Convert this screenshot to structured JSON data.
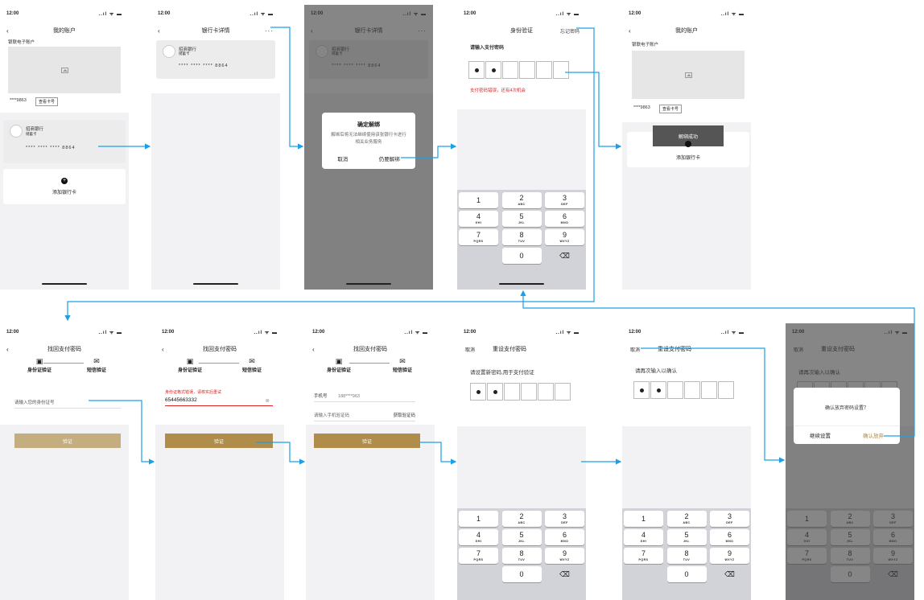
{
  "common": {
    "time": "12:00",
    "signal": "..ıl ᯤ ▬",
    "keys": [
      {
        "n": "1",
        "l": ""
      },
      {
        "n": "2",
        "l": "ABC"
      },
      {
        "n": "3",
        "l": "DEF"
      },
      {
        "n": "4",
        "l": "GHI"
      },
      {
        "n": "5",
        "l": "JKL"
      },
      {
        "n": "6",
        "l": "MNO"
      },
      {
        "n": "7",
        "l": "PQRS"
      },
      {
        "n": "8",
        "l": "TUV"
      },
      {
        "n": "9",
        "l": "WXYZ"
      },
      {
        "n": "",
        "l": ""
      },
      {
        "n": "0",
        "l": ""
      },
      {
        "n": "⌫",
        "l": ""
      }
    ],
    "back": "‹",
    "more": "···",
    "masked_num": "**** **** **** 8864",
    "accent_gold": "#b08d4a",
    "accent_gold_light": "#c4ad7e",
    "error_red": "#e02020",
    "arrow_blue": "#1aa0e6"
  },
  "s1": {
    "title": "我的账户",
    "section": "银联电子账户",
    "acct": "****9863",
    "view_card": "查看卡号",
    "bank": "招商银行",
    "card_type": "储蓄卡",
    "add_card": "添加银行卡"
  },
  "s2": {
    "title": "银行卡详情",
    "bank": "招商银行",
    "card_type": "储蓄卡"
  },
  "s3": {
    "title": "银行卡详情",
    "dialog_title": "确定解绑",
    "dialog_msg": "解绑后将无法继续使用该张银行卡进行相关业务服务",
    "cancel": "取消",
    "confirm": "仍要解绑"
  },
  "s4": {
    "title": "身份验证",
    "forgot": "忘记密码",
    "prompt": "请输入支付密码",
    "error": "支付密码错误，还有4次机会"
  },
  "s5": {
    "title": "我的账户",
    "section": "银联电子账户",
    "acct": "****9863",
    "view_card": "查看卡号",
    "toast": "解绑成功",
    "add_card": "添加银行卡"
  },
  "s6": {
    "title": "找回支付密码",
    "step1": "身份证验证",
    "step2": "短信验证",
    "placeholder": "请输入您的身份证号",
    "btn": "验证"
  },
  "s7": {
    "title": "找回支付密码",
    "step1": "身份证验证",
    "step2": "短信验证",
    "error": "身份证格式错误，请核实后重试",
    "value": "65445663332",
    "btn": "验证"
  },
  "s8": {
    "title": "找回支付密码",
    "step1": "身份证验证",
    "step2": "短信验证",
    "phone_label": "手机号",
    "phone_value": "188****963",
    "code_placeholder": "请输入手机验证码",
    "get_code": "获取验证码",
    "btn": "验证"
  },
  "s9": {
    "cancel": "取消",
    "title": "重设支付密码",
    "prompt": "请设置新密码,用于支付验证"
  },
  "s10": {
    "cancel": "取消",
    "title": "重设支付密码",
    "prompt": "请再次输入以确认"
  },
  "s11": {
    "cancel": "取消",
    "title": "重设支付密码",
    "prompt": "请再次输入以确认",
    "dialog_msg": "确认放弃密码设置？",
    "continue": "继续设置",
    "abandon": "确认放弃"
  }
}
